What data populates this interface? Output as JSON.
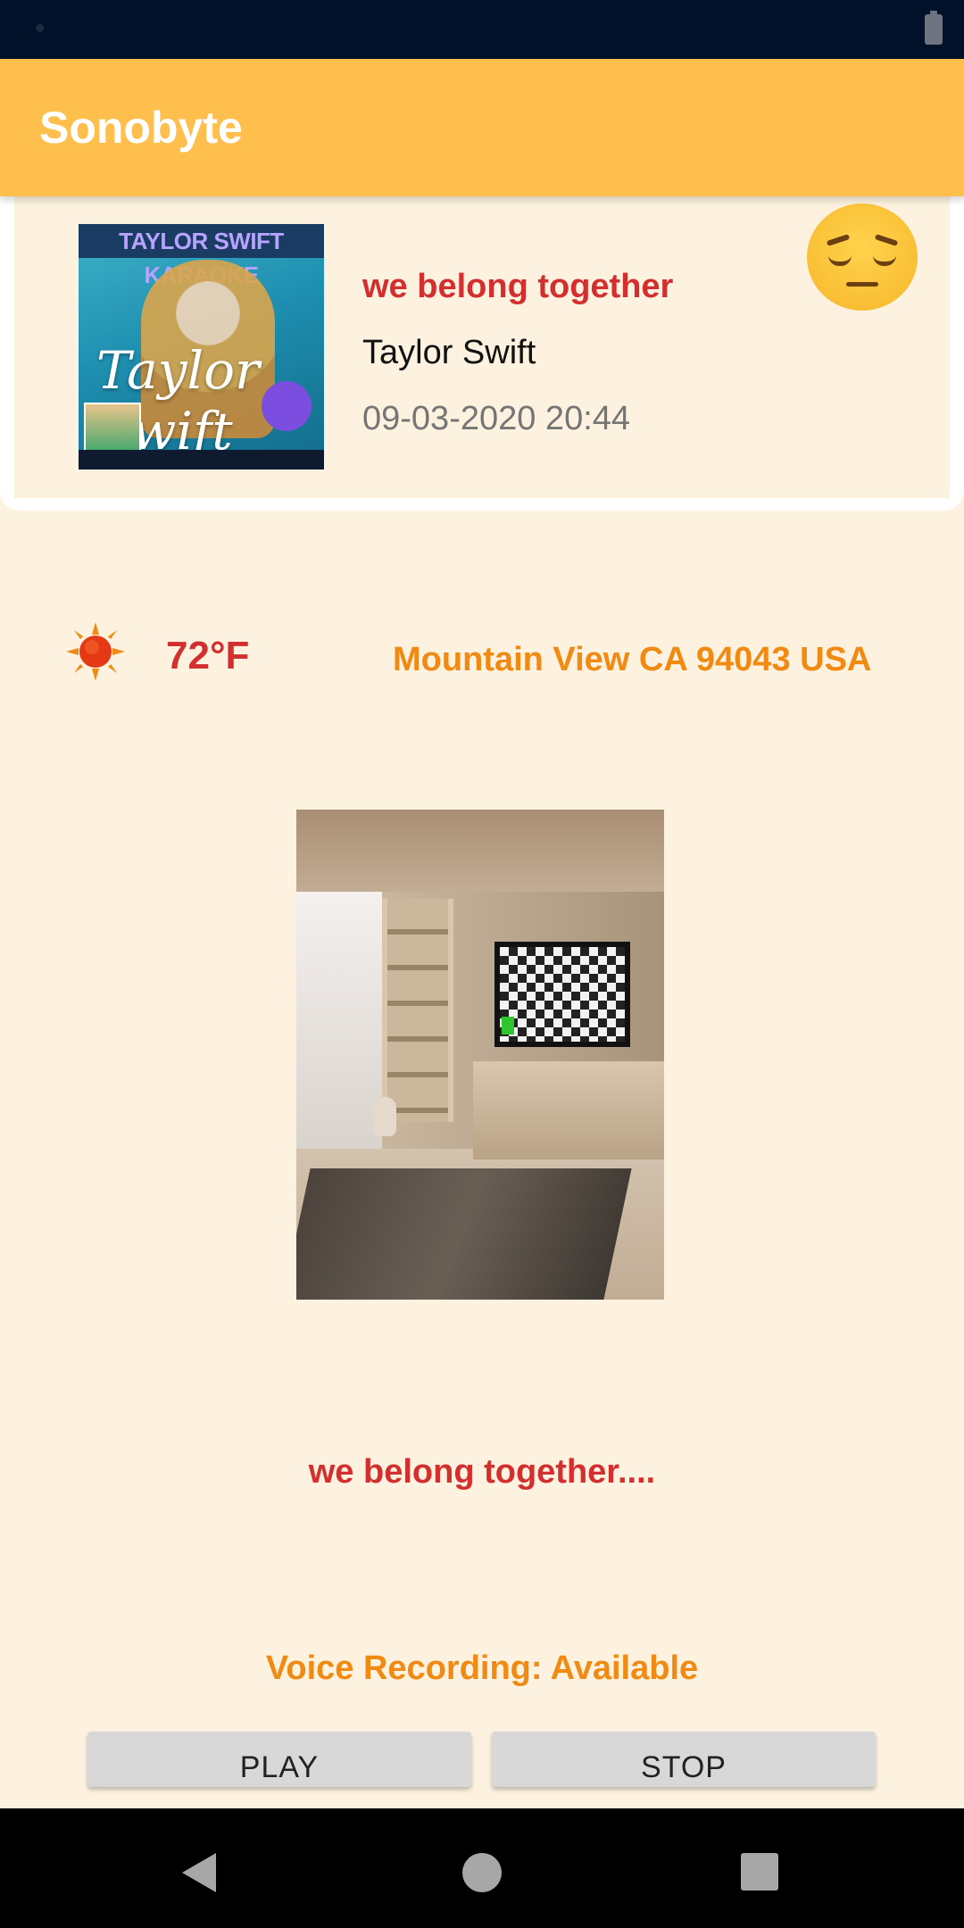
{
  "app_bar": {
    "title": "Sonobyte"
  },
  "song_card": {
    "album_art_label": "TAYLOR SWIFT KARAOKE",
    "album_art_script": "Taylor Swift",
    "title": "we belong together",
    "artist": "Taylor Swift",
    "timestamp": "09-03-2020 20:44",
    "mood_icon": "pensive-face-icon"
  },
  "weather": {
    "icon": "sun-icon",
    "temperature": "72°F",
    "location": "Mountain View CA 94043 USA"
  },
  "scene_image": {
    "icon": "living-room-image"
  },
  "caption": "we belong together....",
  "recording_status": "Voice Recording: Available",
  "controls": {
    "play_label": "PLAY",
    "stop_label": "STOP"
  },
  "navigation": {
    "back_icon": "back-icon",
    "home_icon": "home-icon",
    "recents_icon": "recents-icon"
  },
  "colors": {
    "app_bar": "#ffbf4d",
    "background": "#fdf2df",
    "title_red": "#d32f2f",
    "accent_orange": "#f08a12"
  }
}
